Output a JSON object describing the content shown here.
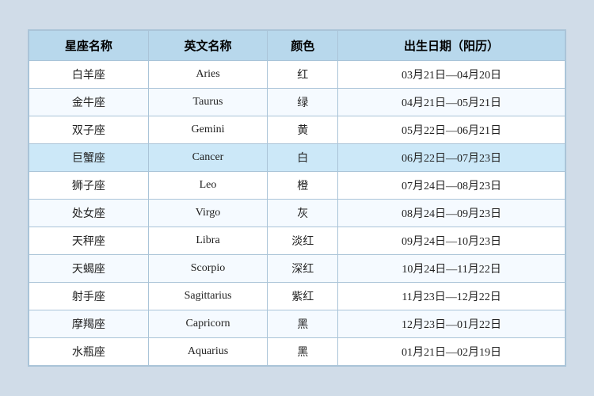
{
  "table": {
    "headers": [
      "星座名称",
      "英文名称",
      "颜色",
      "出生日期（阳历）"
    ],
    "rows": [
      {
        "chinese": "白羊座",
        "english": "Aries",
        "color": "红",
        "dates": "03月21日—04月20日",
        "highlight": false
      },
      {
        "chinese": "金牛座",
        "english": "Taurus",
        "color": "绿",
        "dates": "04月21日—05月21日",
        "highlight": false
      },
      {
        "chinese": "双子座",
        "english": "Gemini",
        "color": "黄",
        "dates": "05月22日—06月21日",
        "highlight": false
      },
      {
        "chinese": "巨蟹座",
        "english": "Cancer",
        "color": "白",
        "dates": "06月22日—07月23日",
        "highlight": true
      },
      {
        "chinese": "狮子座",
        "english": "Leo",
        "color": "橙",
        "dates": "07月24日—08月23日",
        "highlight": false
      },
      {
        "chinese": "处女座",
        "english": "Virgo",
        "color": "灰",
        "dates": "08月24日—09月23日",
        "highlight": false
      },
      {
        "chinese": "天秤座",
        "english": "Libra",
        "color": "淡红",
        "dates": "09月24日—10月23日",
        "highlight": false
      },
      {
        "chinese": "天蝎座",
        "english": "Scorpio",
        "color": "深红",
        "dates": "10月24日—11月22日",
        "highlight": false
      },
      {
        "chinese": "射手座",
        "english": "Sagittarius",
        "color": "紫红",
        "dates": "11月23日—12月22日",
        "highlight": false
      },
      {
        "chinese": "摩羯座",
        "english": "Capricorn",
        "color": "黑",
        "dates": "12月23日—01月22日",
        "highlight": false
      },
      {
        "chinese": "水瓶座",
        "english": "Aquarius",
        "color": "黑",
        "dates": "01月21日—02月19日",
        "highlight": false
      }
    ]
  }
}
